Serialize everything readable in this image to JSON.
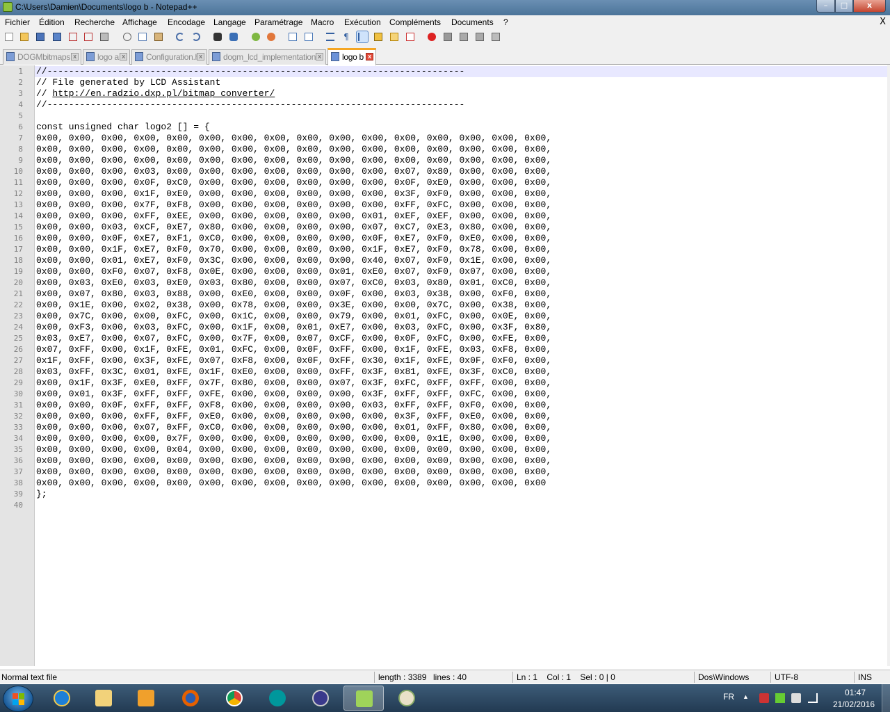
{
  "window": {
    "title": "C:\\Users\\Damien\\Documents\\logo b - Notepad++",
    "minimize_glyph": "–",
    "maximize_glyph": "□",
    "close_glyph": "x"
  },
  "menu": {
    "items": [
      "Fichier",
      "Édition",
      "Recherche",
      "Affichage",
      "Encodage",
      "Langage",
      "Paramétrage",
      "Macro",
      "Exécution",
      "Compléments",
      "Documents",
      "?"
    ],
    "close": "X"
  },
  "toolbar": {
    "icons": [
      "new-file-icon",
      "open-file-icon",
      "save-icon",
      "save-all-icon",
      "close-icon",
      "close-all-icon",
      "print-icon",
      "cut-icon",
      "copy-icon",
      "paste-icon",
      "undo-icon",
      "redo-icon",
      "find-icon",
      "replace-icon",
      "zoom-in-icon",
      "zoom-out-icon",
      "sync-vertical-icon",
      "sync-horizontal-icon",
      "word-wrap-icon",
      "show-all-chars-icon",
      "indent-guide-icon",
      "udl-icon",
      "doc-map-icon",
      "function-list-icon",
      "record-macro-icon",
      "stop-macro-icon",
      "play-macro-icon",
      "run-macro-multiple-icon",
      "save-macro-icon"
    ]
  },
  "tabs": [
    {
      "label": "DOGMbitmaps.h",
      "active": false
    },
    {
      "label": "logo a",
      "active": false
    },
    {
      "label": "Configuration.h",
      "active": false
    },
    {
      "label": "dogm_lcd_implementation.h",
      "active": false
    },
    {
      "label": "logo b",
      "active": true
    }
  ],
  "editor": {
    "lines": [
      "//-----------------------------------------------------------------------------",
      "// File generated by LCD Assistant",
      "// http://en.radzio.dxp.pl/bitmap_converter/",
      "//-----------------------------------------------------------------------------",
      "",
      "const unsigned char logo2 [] = {",
      "0x00, 0x00, 0x00, 0x00, 0x00, 0x00, 0x00, 0x00, 0x00, 0x00, 0x00, 0x00, 0x00, 0x00, 0x00, 0x00,",
      "0x00, 0x00, 0x00, 0x00, 0x00, 0x00, 0x00, 0x00, 0x00, 0x00, 0x00, 0x00, 0x00, 0x00, 0x00, 0x00,",
      "0x00, 0x00, 0x00, 0x00, 0x00, 0x00, 0x00, 0x00, 0x00, 0x00, 0x00, 0x00, 0x00, 0x00, 0x00, 0x00,",
      "0x00, 0x00, 0x00, 0x03, 0x00, 0x00, 0x00, 0x00, 0x00, 0x00, 0x00, 0x07, 0x80, 0x00, 0x00, 0x00,",
      "0x00, 0x00, 0x00, 0x0F, 0xC0, 0x00, 0x00, 0x00, 0x00, 0x00, 0x00, 0x0F, 0xE0, 0x00, 0x00, 0x00,",
      "0x00, 0x00, 0x00, 0x1F, 0xE0, 0x00, 0x00, 0x00, 0x00, 0x00, 0x00, 0x3F, 0xF0, 0x00, 0x00, 0x00,",
      "0x00, 0x00, 0x00, 0x7F, 0xF8, 0x00, 0x00, 0x00, 0x00, 0x00, 0x00, 0xFF, 0xFC, 0x00, 0x00, 0x00,",
      "0x00, 0x00, 0x00, 0xFF, 0xEE, 0x00, 0x00, 0x00, 0x00, 0x00, 0x01, 0xEF, 0xEF, 0x00, 0x00, 0x00,",
      "0x00, 0x00, 0x03, 0xCF, 0xE7, 0x80, 0x00, 0x00, 0x00, 0x00, 0x07, 0xC7, 0xE3, 0x80, 0x00, 0x00,",
      "0x00, 0x00, 0x0F, 0xE7, 0xF1, 0xC0, 0x00, 0x00, 0x00, 0x00, 0x0F, 0xE7, 0xF0, 0xE0, 0x00, 0x00,",
      "0x00, 0x00, 0x1F, 0xE7, 0xF0, 0x70, 0x00, 0x00, 0x00, 0x00, 0x1F, 0xE7, 0xF0, 0x78, 0x00, 0x00,",
      "0x00, 0x00, 0x01, 0xE7, 0xF0, 0x3C, 0x00, 0x00, 0x00, 0x00, 0x40, 0x07, 0xF0, 0x1E, 0x00, 0x00,",
      "0x00, 0x00, 0xF0, 0x07, 0xF8, 0x0E, 0x00, 0x00, 0x00, 0x01, 0xE0, 0x07, 0xF0, 0x07, 0x00, 0x00,",
      "0x00, 0x03, 0xE0, 0x03, 0xE0, 0x03, 0x80, 0x00, 0x00, 0x07, 0xC0, 0x03, 0x80, 0x01, 0xC0, 0x00,",
      "0x00, 0x07, 0x80, 0x03, 0x88, 0x00, 0xE0, 0x00, 0x00, 0x0F, 0x00, 0x03, 0x38, 0x00, 0xF0, 0x00,",
      "0x00, 0x1E, 0x00, 0x02, 0x38, 0x00, 0x78, 0x00, 0x00, 0x3E, 0x00, 0x00, 0x7C, 0x00, 0x38, 0x00,",
      "0x00, 0x7C, 0x00, 0x00, 0xFC, 0x00, 0x1C, 0x00, 0x00, 0x79, 0x00, 0x01, 0xFC, 0x00, 0x0E, 0x00,",
      "0x00, 0xF3, 0x00, 0x03, 0xFC, 0x00, 0x1F, 0x00, 0x01, 0xE7, 0x00, 0x03, 0xFC, 0x00, 0x3F, 0x80,",
      "0x03, 0xE7, 0x00, 0x07, 0xFC, 0x00, 0x7F, 0x00, 0x07, 0xCF, 0x00, 0x0F, 0xFC, 0x00, 0xFE, 0x00,",
      "0x07, 0xFF, 0x00, 0x1F, 0xFE, 0x01, 0xFC, 0x00, 0x0F, 0xFF, 0x00, 0x1F, 0xFE, 0x03, 0xF8, 0x00,",
      "0x1F, 0xFF, 0x00, 0x3F, 0xFE, 0x07, 0xF8, 0x00, 0x0F, 0xFF, 0x30, 0x1F, 0xFE, 0x0F, 0xF0, 0x00,",
      "0x03, 0xFF, 0x3C, 0x01, 0xFE, 0x1F, 0xE0, 0x00, 0x00, 0xFF, 0x3F, 0x81, 0xFE, 0x3F, 0xC0, 0x00,",
      "0x00, 0x1F, 0x3F, 0xE0, 0xFF, 0x7F, 0x80, 0x00, 0x00, 0x07, 0x3F, 0xFC, 0xFF, 0xFF, 0x00, 0x00,",
      "0x00, 0x01, 0x3F, 0xFF, 0xFF, 0xFE, 0x00, 0x00, 0x00, 0x00, 0x3F, 0xFF, 0xFF, 0xFC, 0x00, 0x00,",
      "0x00, 0x00, 0x0F, 0xFF, 0xFF, 0xF8, 0x00, 0x00, 0x00, 0x00, 0x03, 0xFF, 0xFF, 0xF0, 0x00, 0x00,",
      "0x00, 0x00, 0x00, 0xFF, 0xFF, 0xE0, 0x00, 0x00, 0x00, 0x00, 0x00, 0x3F, 0xFF, 0xE0, 0x00, 0x00,",
      "0x00, 0x00, 0x00, 0x07, 0xFF, 0xC0, 0x00, 0x00, 0x00, 0x00, 0x00, 0x01, 0xFF, 0x80, 0x00, 0x00,",
      "0x00, 0x00, 0x00, 0x00, 0x7F, 0x00, 0x00, 0x00, 0x00, 0x00, 0x00, 0x00, 0x1E, 0x00, 0x00, 0x00,",
      "0x00, 0x00, 0x00, 0x00, 0x04, 0x00, 0x00, 0x00, 0x00, 0x00, 0x00, 0x00, 0x00, 0x00, 0x00, 0x00,",
      "0x00, 0x00, 0x00, 0x00, 0x00, 0x00, 0x00, 0x00, 0x00, 0x00, 0x00, 0x00, 0x00, 0x00, 0x00, 0x00,",
      "0x00, 0x00, 0x00, 0x00, 0x00, 0x00, 0x00, 0x00, 0x00, 0x00, 0x00, 0x00, 0x00, 0x00, 0x00, 0x00,",
      "0x00, 0x00, 0x00, 0x00, 0x00, 0x00, 0x00, 0x00, 0x00, 0x00, 0x00, 0x00, 0x00, 0x00, 0x00, 0x00",
      "};",
      ""
    ],
    "current_line": 1
  },
  "statusbar": {
    "file_type": "Normal text file",
    "length": "length : 3389",
    "lines": "lines : 40",
    "position": "Ln : 1    Col : 1    Sel : 0 | 0",
    "eol": "Dos\\Windows",
    "encoding": "UTF-8",
    "mode": "INS"
  },
  "taskbar": {
    "apps": [
      "internet-explorer-icon",
      "file-explorer-icon",
      "media-player-icon",
      "firefox-icon",
      "chrome-icon",
      "arduino-icon",
      "webcam-app-icon",
      "notepad-plus-plus-icon",
      "paint-icon"
    ],
    "active_app": "notepad-plus-plus-icon",
    "tray": {
      "language": "FR",
      "time": "01:47",
      "date": "21/02/2016"
    }
  },
  "colors": {
    "title_bar": "#4b7499",
    "active_tab_accent": "#f5a623",
    "current_line": "#e8e8ff",
    "gutter": "#e4e4e4"
  }
}
